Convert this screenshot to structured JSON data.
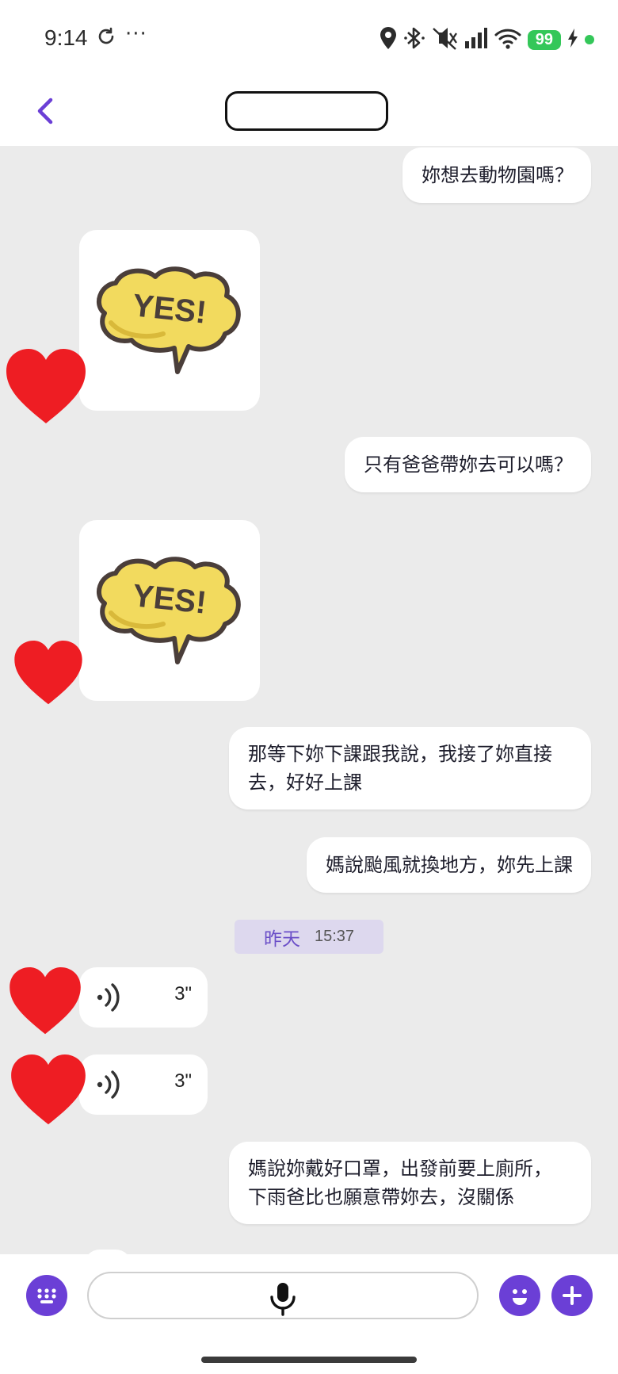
{
  "status_bar": {
    "time": "9:14",
    "dots": "···",
    "battery": "99",
    "icons": [
      "sync-icon",
      "location-icon",
      "bluetooth-icon",
      "mute-icon",
      "signal-icon",
      "wifi-icon",
      "charging-icon"
    ]
  },
  "header": {
    "back_icon": "chevron-left-icon",
    "title": ""
  },
  "messages": {
    "m1": "妳想去動物園嗎？",
    "sticker1": "YES!",
    "m2": "只有爸爸帶妳去可以嗎？",
    "sticker2": "YES!",
    "m3_line1": "那等下妳下課跟我說，我接了妳直接",
    "m3_line2": "去，好好上課",
    "m4": "媽說颱風就換地方，妳先上課",
    "m5_line1": "媽說妳戴好口罩，出發前要上廁所，",
    "m5_line2": "下雨爸比也願意帶妳去，沒關係"
  },
  "date_chip": {
    "day": "昨天",
    "time": "15:37"
  },
  "voice_messages": [
    {
      "duration": "3\""
    },
    {
      "duration": "3\""
    }
  ],
  "input_bar": {
    "keyboard_icon": "keyboard-icon",
    "mic_icon": "microphone-icon",
    "emoji_icon": "smiley-icon",
    "plus_icon": "plus-icon"
  },
  "colors": {
    "accent": "#6b3fd6",
    "chat_bg": "#ebebeb",
    "date_chip_bg": "#ddd8ee",
    "heart": "#ee1d23",
    "sticker_yellow": "#f2da5e"
  }
}
